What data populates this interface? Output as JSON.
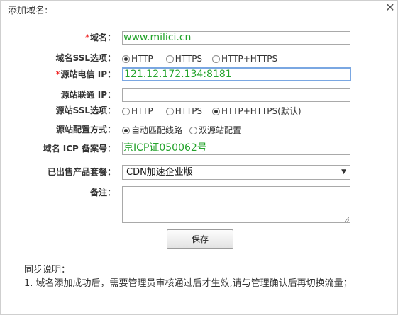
{
  "dialog": {
    "title": "添加域名:",
    "close_icon": "close-icon"
  },
  "form": {
    "domain": {
      "label": "域名：",
      "value": "www.milici.cn",
      "required_mark": "*"
    },
    "domain_ssl": {
      "label": "域名SSL选项：",
      "options": [
        "HTTP",
        "HTTPS",
        "HTTP+HTTPS"
      ],
      "selected": "HTTP"
    },
    "origin_telecom_ip": {
      "label": "源站电信 IP：",
      "value": "121.12.172.134:8181",
      "required_mark": "*"
    },
    "origin_unicom_ip": {
      "label": "源站联通 IP：",
      "value": ""
    },
    "origin_ssl": {
      "label": "源站SSL选项：",
      "options": [
        "HTTP",
        "HTTPS",
        "HTTP+HTTPS(默认)"
      ],
      "selected": "HTTP+HTTPS(默认)"
    },
    "origin_config": {
      "label": "源站配置方式：",
      "options": [
        "自动匹配线路",
        "双源站配置"
      ],
      "selected": "自动匹配线路"
    },
    "icp": {
      "label": "域名 ICP 备案号：",
      "value": "京ICP证050062号"
    },
    "package": {
      "label": "已出售产品套餐：",
      "value": "CDN加速企业版"
    },
    "remark": {
      "label": "备注：",
      "value": ""
    },
    "save_label": "保存"
  },
  "notes": {
    "heading": "同步说明：",
    "items": [
      "1. 域名添加成功后，需要管理员审核通过后才生效,请与管理确认后再切换流量；"
    ]
  },
  "colors": {
    "input_text": "#23a32b",
    "required": "#e00000",
    "focus_border": "#7aa7e2"
  }
}
